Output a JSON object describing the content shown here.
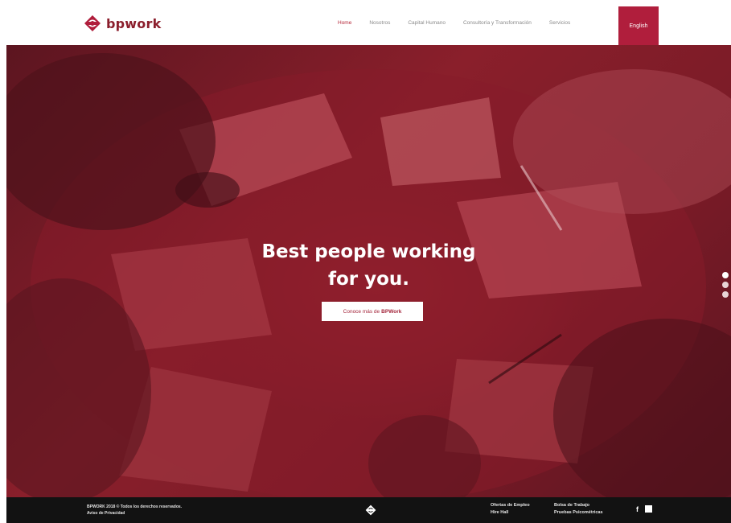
{
  "brand": {
    "name": "bpwork",
    "accent": "#b01e3c",
    "dark": "#121212"
  },
  "nav": {
    "items": [
      {
        "label": "Home",
        "active": true
      },
      {
        "label": "Nosotros"
      },
      {
        "label": "Capital Humano"
      },
      {
        "label": "Consultoría y Transformación"
      },
      {
        "label": "Servicios"
      }
    ],
    "cta": "English"
  },
  "hero": {
    "title_line1": "Best people working",
    "title_line2": "for you.",
    "button_text": "Conoce más de",
    "button_brand": "BPWork",
    "slides": 3,
    "active_slide": 1
  },
  "footer": {
    "copyright": "BPWORK 2018 © Todos los derechos reservados.",
    "privacy": "Aviso de Privacidad",
    "links_col1": [
      "Ofertas de Empleo",
      "Hire Hall"
    ],
    "links_col2": [
      "Bolsa de Trabajo",
      "Pruebas Psicométricas"
    ],
    "social": [
      "facebook-icon",
      "linkedin-icon"
    ]
  }
}
